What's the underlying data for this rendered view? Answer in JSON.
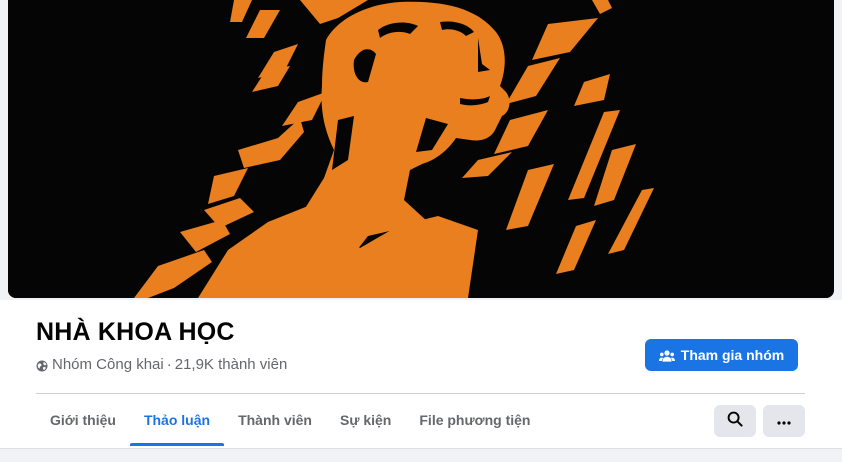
{
  "group": {
    "name": "NHÀ KHOA HỌC",
    "privacy": "Nhóm Công khai",
    "separator": "·",
    "members": "21,9K thành viên"
  },
  "actions": {
    "join_label": "Tham gia nhóm",
    "join_icon": "people-icon",
    "search_icon": "search-icon",
    "more_icon": "more-icon"
  },
  "tabs": [
    {
      "label": "Giới thiệu",
      "active": false
    },
    {
      "label": "Thảo luận",
      "active": true
    },
    {
      "label": "Thành viên",
      "active": false
    },
    {
      "label": "Sự kiện",
      "active": false
    },
    {
      "label": "File phương tiện",
      "active": false
    }
  ],
  "colors": {
    "accent": "#1b74e4",
    "cover_background": "#050505",
    "cover_art": "#e97f1e"
  }
}
